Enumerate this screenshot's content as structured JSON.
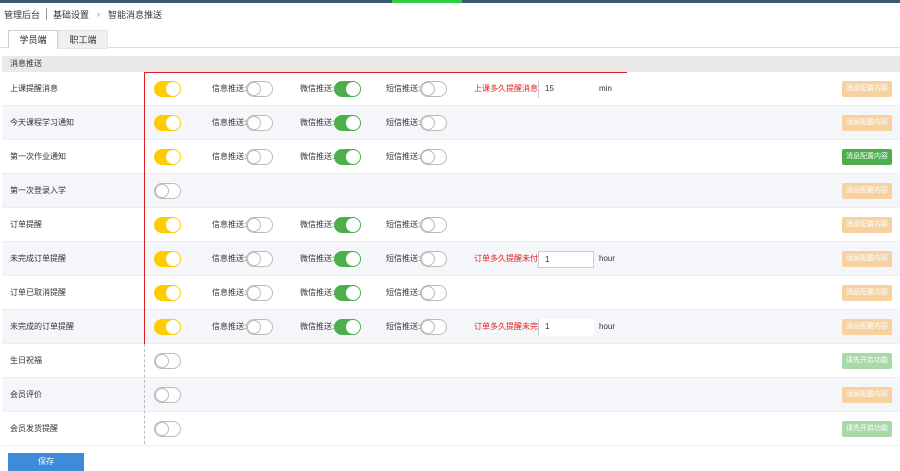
{
  "breadcrumb": {
    "items": [
      "管理后台",
      "基础设置",
      "智能消息推送"
    ]
  },
  "tabs": [
    {
      "label": "学员端",
      "active": true
    },
    {
      "label": "职工端",
      "active": false
    }
  ],
  "section": {
    "title": "消息推送"
  },
  "channel_labels": {
    "info": "信息推送:",
    "wechat": "微信推送:",
    "sms": "短信推送:"
  },
  "rows": [
    {
      "label": "上课提醒消息",
      "enabled": true,
      "info": false,
      "wechat": true,
      "sms": false,
      "extra": {
        "label": "上课多久提醒消息:",
        "value": "15",
        "unit": "min",
        "boxed": false
      },
      "button": {
        "label": "消息配置内容",
        "style": "orange"
      }
    },
    {
      "label": "今天课程学习通知",
      "enabled": true,
      "info": false,
      "wechat": true,
      "sms": false,
      "extra": null,
      "button": {
        "label": "消息配置内容",
        "style": "orange"
      }
    },
    {
      "label": "第一次作业通知",
      "enabled": true,
      "info": false,
      "wechat": true,
      "sms": false,
      "extra": null,
      "button": {
        "label": "消息配置内容",
        "style": "green"
      }
    },
    {
      "label": "第一次登录入学",
      "enabled": false,
      "info": null,
      "wechat": null,
      "sms": null,
      "extra": null,
      "button": {
        "label": "消息配置内容",
        "style": "orange"
      }
    },
    {
      "label": "订单提醒",
      "enabled": true,
      "info": false,
      "wechat": true,
      "sms": false,
      "extra": null,
      "button": {
        "label": "消息配置内容",
        "style": "orange"
      }
    },
    {
      "label": "未完成订单提醒",
      "enabled": true,
      "info": false,
      "wechat": true,
      "sms": false,
      "extra": {
        "label": "订单多久提醒未付款:",
        "value": "1",
        "unit": "hour",
        "boxed": true
      },
      "button": {
        "label": "消息配置内容",
        "style": "orange"
      }
    },
    {
      "label": "订单已取消提醒",
      "enabled": true,
      "info": false,
      "wechat": true,
      "sms": false,
      "extra": null,
      "button": {
        "label": "消息配置内容",
        "style": "orange"
      }
    },
    {
      "label": "未完成的订单提醒",
      "enabled": true,
      "info": false,
      "wechat": true,
      "sms": false,
      "extra": {
        "label": "订单多久提醒未完成:",
        "value": "1",
        "unit": "hour",
        "boxed": false
      },
      "button": {
        "label": "消息配置内容",
        "style": "orange"
      }
    },
    {
      "label": "生日祝福",
      "enabled": false,
      "info": null,
      "wechat": null,
      "sms": null,
      "extra": null,
      "button": {
        "label": "请先开启功能",
        "style": "lightgreen"
      }
    },
    {
      "label": "会员评价",
      "enabled": false,
      "info": null,
      "wechat": null,
      "sms": null,
      "extra": null,
      "button": {
        "label": "消息配置内容",
        "style": "orange"
      }
    },
    {
      "label": "会员发货提醒",
      "enabled": false,
      "info": null,
      "wechat": null,
      "sms": null,
      "extra": null,
      "button": {
        "label": "请先开启功能",
        "style": "lightgreen"
      }
    }
  ],
  "footer": {
    "save_label": "保存"
  },
  "colors": {
    "toggle_on": "#ffcc00",
    "toggle_wechat": "#4cae4c",
    "accent_red": "#e02020",
    "save_blue": "#3d8bd9"
  }
}
